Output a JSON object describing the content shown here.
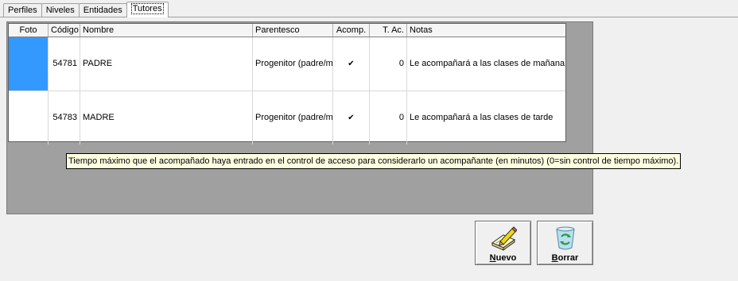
{
  "tabs": [
    {
      "label": "Perfiles"
    },
    {
      "label": "Niveles"
    },
    {
      "label": "Entidades"
    },
    {
      "label": "Tutores"
    }
  ],
  "grid": {
    "columns": [
      "Foto",
      "Código",
      "Nombre",
      "Parentesco",
      "Acomp.",
      "T. Ac.",
      "Notas"
    ],
    "rows": [
      {
        "foto": "",
        "codigo": "54781",
        "nombre": "PADRE",
        "parentesco": "Progenitor (padre/m",
        "acomp": true,
        "tac": "0",
        "notas": "Le acompañará a las clases de mañana"
      },
      {
        "foto": "",
        "codigo": "54783",
        "nombre": "MADRE",
        "parentesco": "Progenitor (padre/m",
        "acomp": true,
        "tac": "0",
        "notas": "Le acompañará a las clases de tarde"
      }
    ],
    "check_glyph": "✔"
  },
  "tooltip": {
    "text": "Tiempo máximo que el acompañado haya entrado en el control de acceso para considerarlo un acompañante (en minutos) (0=sin control de tiempo máximo)."
  },
  "buttons": {
    "nuevo": {
      "underline": "N",
      "rest": "uevo",
      "icon": "new-document-pencil-icon"
    },
    "borrar": {
      "underline": "B",
      "rest": "orrar",
      "icon": "recycle-bin-icon"
    }
  },
  "colors": {
    "selection": "#3399ff",
    "tooltip_bg": "#ffffe1",
    "grid_bg": "#a0a0a0"
  }
}
